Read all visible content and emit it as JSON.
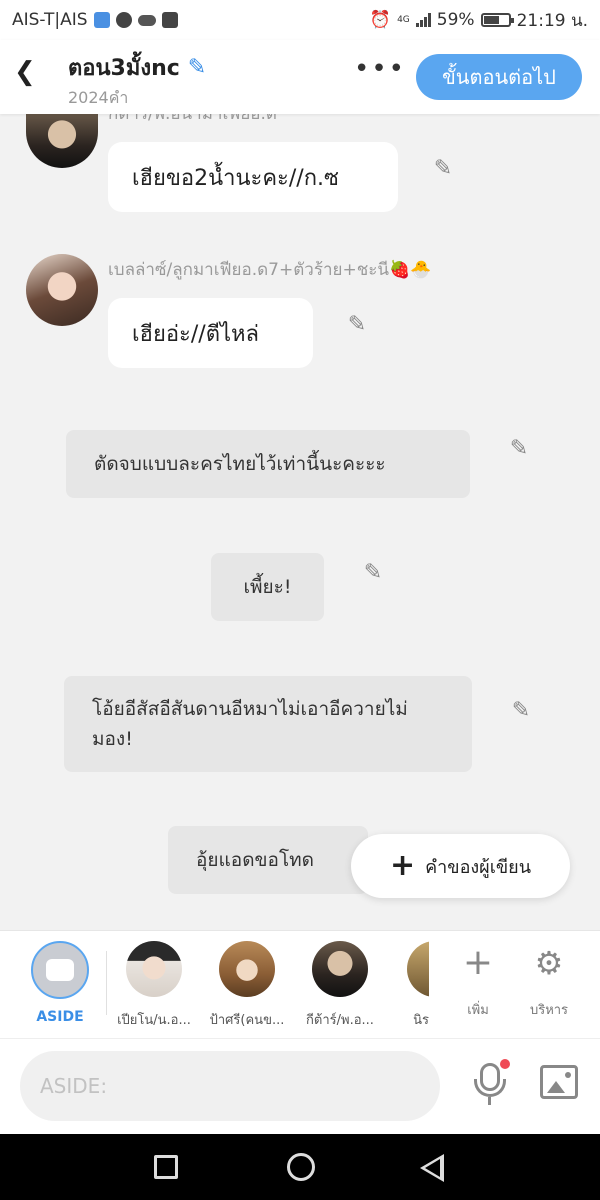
{
  "status_bar": {
    "carrier": "AIS-T|AIS",
    "network": "4G",
    "battery": "59%",
    "time": "21:19 น."
  },
  "header": {
    "title": "ตอน3มั้งnc",
    "word_count": "2024คำ",
    "more_label": "•••",
    "next_label": "ขั้นตอนต่อไป"
  },
  "messages": [
    {
      "sender": "กีต้าร์/พ.อนามาเฟียอ.ด",
      "text": "เฮียขอ2น้ำนะคะ//ก.ซ",
      "type": "character"
    },
    {
      "sender": "เบลล่าซ์/ลูกมาเฟียอ.ด7+ตัวร้าย+ชะนี🍓🐣",
      "text": "เฮียอ่ะ//ตีไหล่",
      "type": "character"
    },
    {
      "text": "ตัดจบแบบละครไทยไว้เท่านี้นะคะะะ",
      "type": "narration"
    },
    {
      "text": "เพี้ยะ!",
      "type": "narration"
    },
    {
      "text": "โอ้ยอีสัสอีสันดานอีหมาไม่เอาอีควายไม่มอง!",
      "type": "narration"
    },
    {
      "text": "อุ้ยแอดขอโทด",
      "type": "narration"
    }
  ],
  "fab": {
    "label": "คำของผู้เขียน"
  },
  "characters": [
    {
      "label": "ASIDE",
      "kind": "aside"
    },
    {
      "label": "เปียโน/น.อ...",
      "kind": "character"
    },
    {
      "label": "ป้าศรี(คนข...",
      "kind": "character"
    },
    {
      "label": "กีต้าร์/พ.อ...",
      "kind": "character"
    },
    {
      "label": "นิร",
      "kind": "character"
    }
  ],
  "tools": [
    {
      "label": "เพิ่ม",
      "icon": "plus-icon"
    },
    {
      "label": "บริหาร",
      "icon": "gear-icon"
    }
  ],
  "input": {
    "placeholder": "ASIDE:"
  },
  "colors": {
    "accent": "#5aa6f0",
    "notification_dot": "#ef4a55"
  }
}
